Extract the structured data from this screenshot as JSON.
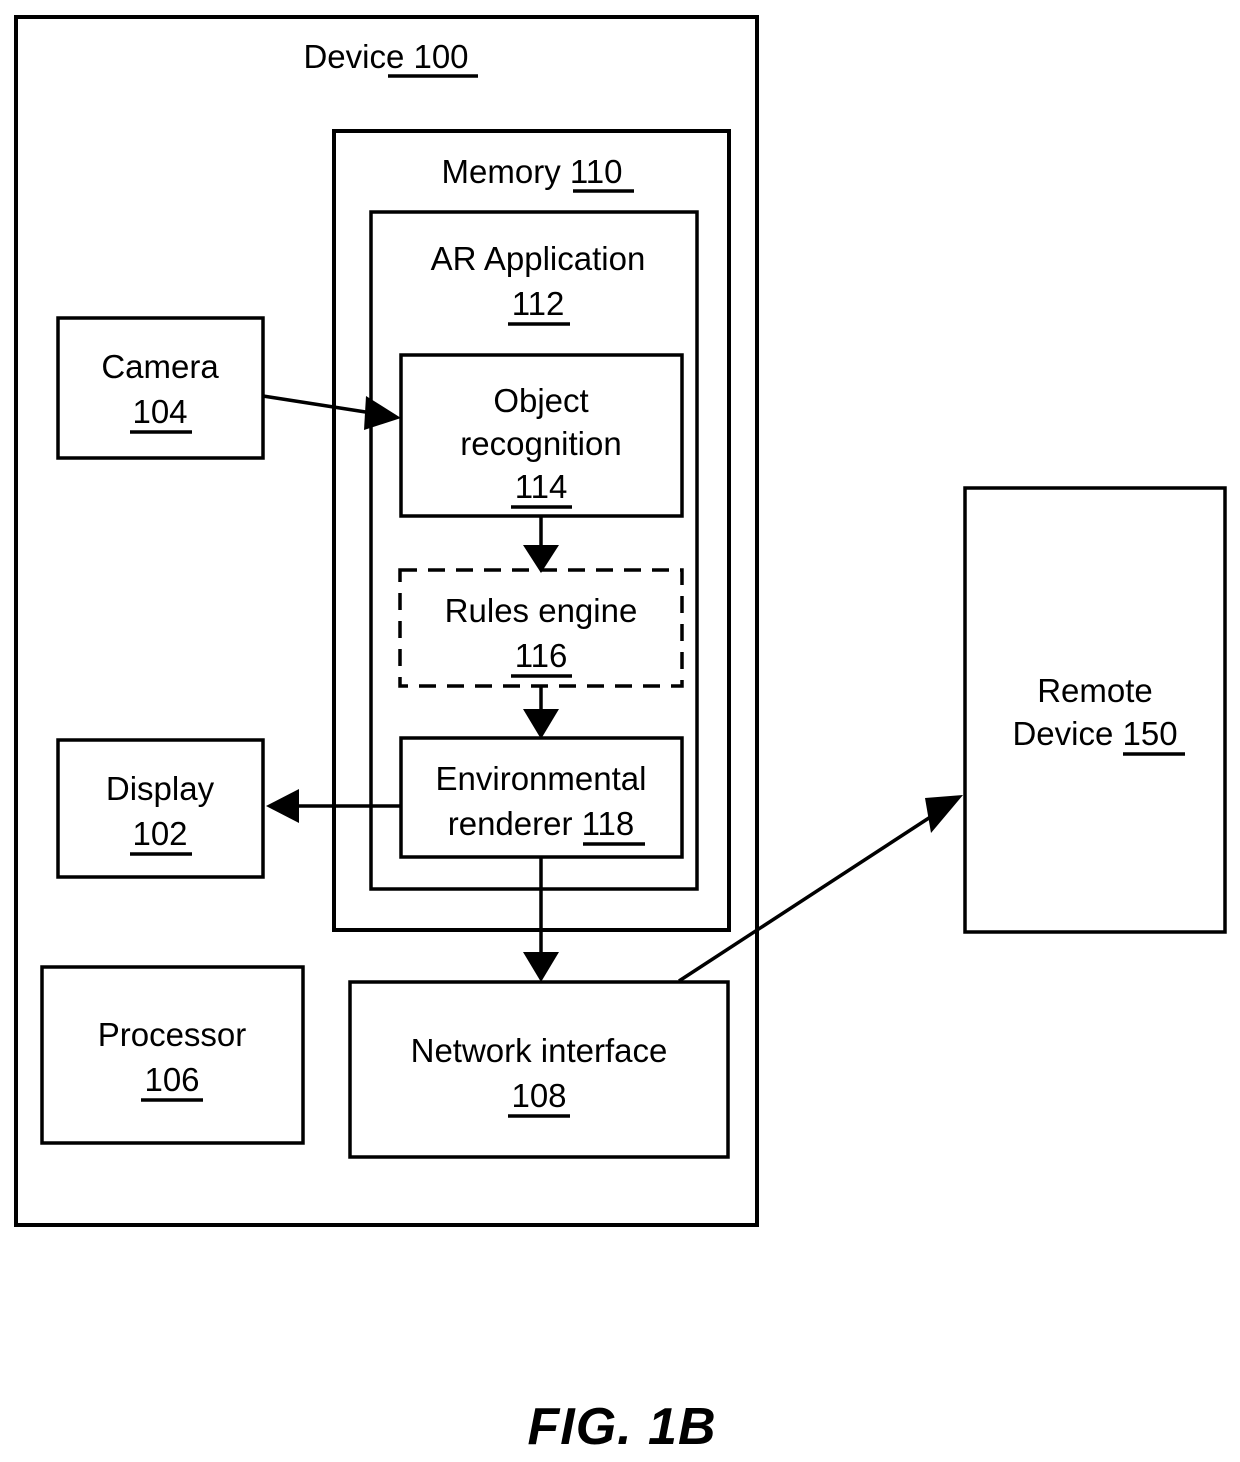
{
  "figure": {
    "caption": "FIG. 1B",
    "type": "patent-block-diagram"
  },
  "blocks": {
    "device": {
      "name": "Device",
      "ref": "100",
      "label": "Device 100"
    },
    "memory": {
      "name": "Memory",
      "ref": "110",
      "label": "Memory 110"
    },
    "ar_application": {
      "name": "AR Application",
      "ref": "112",
      "line1": "AR Application",
      "line2": "112"
    },
    "object_recognition": {
      "name": "Object recognition",
      "ref": "114",
      "line1": "Object",
      "line2": "recognition",
      "line3": "114"
    },
    "rules_engine": {
      "name": "Rules engine",
      "ref": "116",
      "line1": "Rules engine",
      "line2": "116",
      "style": "dashed"
    },
    "environmental_renderer": {
      "name": "Environmental renderer",
      "ref": "118",
      "line1": "Environmental",
      "line2_text": "renderer ",
      "line2_ref": "118"
    },
    "camera": {
      "name": "Camera",
      "ref": "104",
      "line1": "Camera",
      "line2": "104"
    },
    "display": {
      "name": "Display",
      "ref": "102",
      "line1": "Display",
      "line2": "102"
    },
    "processor": {
      "name": "Processor",
      "ref": "106",
      "line1": "Processor",
      "line2": "106"
    },
    "network_interface": {
      "name": "Network interface",
      "ref": "108",
      "line1": "Network interface",
      "line2": "108"
    },
    "remote_device": {
      "name": "Remote Device",
      "ref": "150",
      "line1": "Remote",
      "line2_text": "Device ",
      "line2_ref": "150"
    }
  },
  "connections": [
    {
      "id": "camera-to-object-recognition",
      "from": "Camera 104",
      "to": "Object recognition 114",
      "style": "solid-arrow"
    },
    {
      "id": "object-recognition-to-rules-engine",
      "from": "Object recognition 114",
      "to": "Rules engine 116",
      "style": "solid-arrow"
    },
    {
      "id": "rules-engine-to-environmental-renderer",
      "from": "Rules engine 116",
      "to": "Environmental renderer 118",
      "style": "solid-arrow"
    },
    {
      "id": "environmental-renderer-to-display",
      "from": "Environmental renderer 118",
      "to": "Display 102",
      "style": "solid-arrow"
    },
    {
      "id": "environmental-renderer-to-network-interface",
      "from": "Environmental renderer 118",
      "to": "Network interface 108",
      "style": "solid-arrow"
    },
    {
      "id": "network-interface-to-remote-device",
      "from": "Network interface 108",
      "to": "Remote Device 150",
      "style": "solid-arrow"
    }
  ],
  "colors": {
    "stroke": "#000000",
    "background": "#ffffff"
  }
}
